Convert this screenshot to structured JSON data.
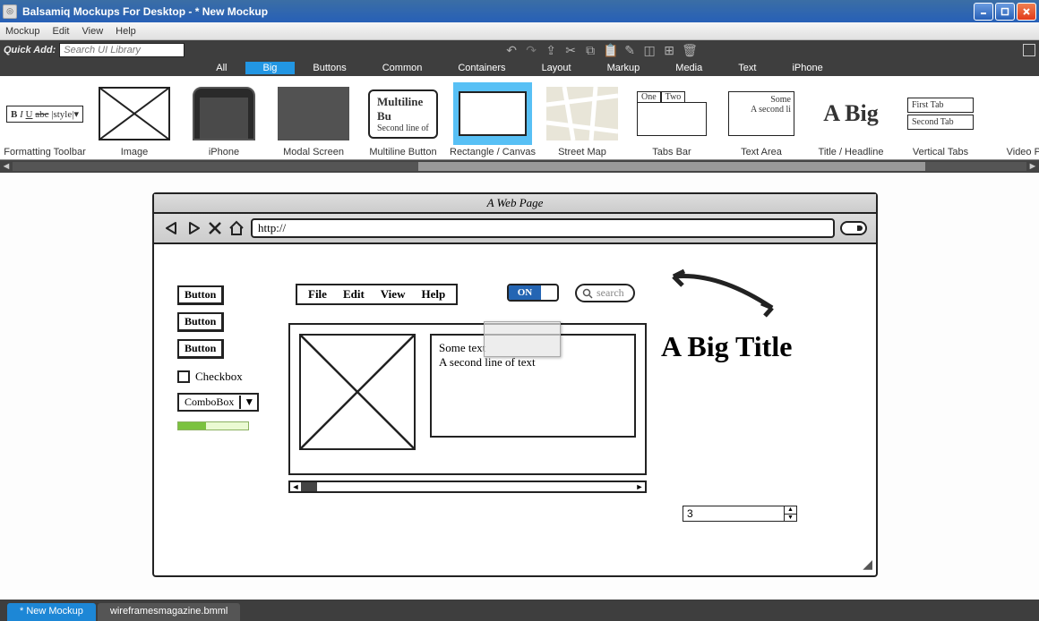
{
  "titlebar": {
    "app": "Balsamiq Mockups For Desktop",
    "doc": "* New Mockup"
  },
  "menubar": [
    "Mockup",
    "Edit",
    "View",
    "Help"
  ],
  "quickadd": {
    "label": "Quick Add:",
    "placeholder": "Search UI Library"
  },
  "categories": [
    "All",
    "Big",
    "Buttons",
    "Common",
    "Containers",
    "Layout",
    "Markup",
    "Media",
    "Text",
    "iPhone"
  ],
  "activeCategory": "Big",
  "library": [
    {
      "label": "Formatting Toolbar"
    },
    {
      "label": "Image"
    },
    {
      "label": "iPhone"
    },
    {
      "label": "Modal Screen"
    },
    {
      "label": "Multiline Button",
      "t1": "Multiline Bu",
      "t2": "Second line of"
    },
    {
      "label": "Rectangle / Canvas",
      "selected": true
    },
    {
      "label": "Street Map"
    },
    {
      "label": "Tabs Bar",
      "t1": "One",
      "t2": "Two"
    },
    {
      "label": "Text Area",
      "t1": "Some",
      "t2": "A second li"
    },
    {
      "label": "Title / Headline",
      "t1": "A Big"
    },
    {
      "label": "Vertical Tabs",
      "t1": "First Tab",
      "t2": "Second Tab"
    },
    {
      "label": "Video Pl"
    }
  ],
  "browser": {
    "title": "A Web Page",
    "url": "http://",
    "buttons": [
      "Button",
      "Button",
      "Button"
    ],
    "checkbox": "Checkbox",
    "combobox": "ComboBox",
    "menu": [
      "File",
      "Edit",
      "View",
      "Help"
    ],
    "toggle": "ON",
    "searchPlaceholder": "search",
    "textarea": {
      "l1": "Some text",
      "l2": "A second line of text"
    },
    "bigTitle": "A Big Title",
    "stepper": "3"
  },
  "doctabs": {
    "active": "* New Mockup",
    "other": "wireframesmagazine.bmml"
  }
}
